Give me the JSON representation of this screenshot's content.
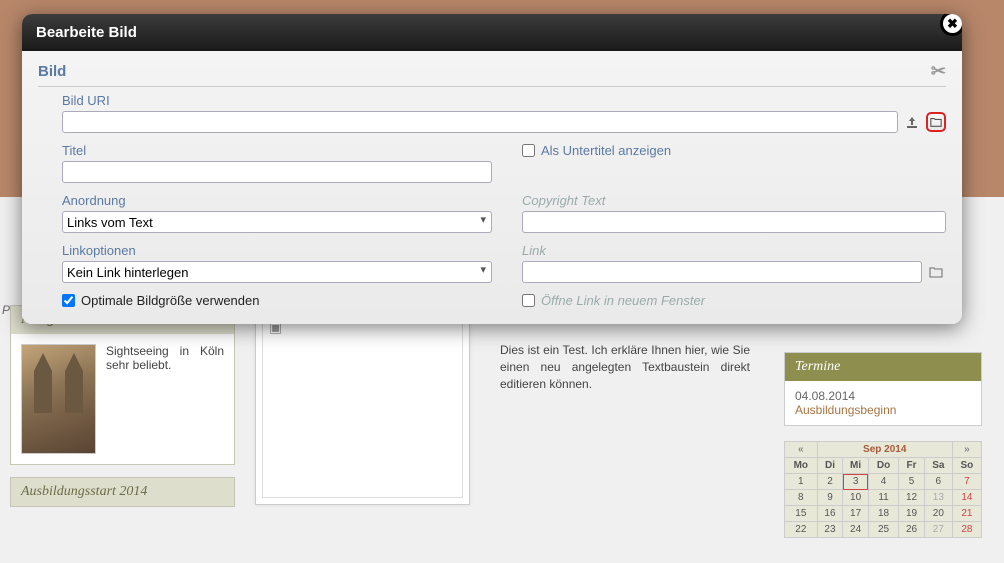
{
  "page": {
    "pl_text": "Pl",
    "center_text": "Dies ist ein Test. Ich erkläre Ihnen hier, wie Sie einen neu angelegten Textbaustein direkt editieren können."
  },
  "news": {
    "heading": "Neuigkeiten aus Köln",
    "item_text": "Sightseeing in Köln sehr beliebt."
  },
  "news2": {
    "heading": "Ausbildungsstart 2014"
  },
  "termine": {
    "heading": "Termine",
    "date": "04.08.2014",
    "title": "Ausbildungsbeginn"
  },
  "calendar": {
    "prev": "«",
    "title": "Sep 2014",
    "next": "»",
    "weekdays": [
      "Mo",
      "Di",
      "Mi",
      "Do",
      "Fr",
      "Sa",
      "So"
    ],
    "rows": [
      [
        "1",
        "2",
        "3",
        "4",
        "5",
        "6",
        "7"
      ],
      [
        "8",
        "9",
        "10",
        "11",
        "12",
        "13",
        "14"
      ],
      [
        "15",
        "16",
        "17",
        "18",
        "19",
        "20",
        "21"
      ],
      [
        "22",
        "23",
        "24",
        "25",
        "26",
        "27",
        "28"
      ]
    ]
  },
  "dialog": {
    "title": "Bearbeite Bild",
    "section": "Bild",
    "uri_label": "Bild URI",
    "titel_label": "Titel",
    "subtitle_label": "Als Untertitel anzeigen",
    "anordnung_label": "Anordnung",
    "anordnung_value": "Links vom Text",
    "copyright_label": "Copyright Text",
    "linkopt_label": "Linkoptionen",
    "linkopt_value": "Kein Link hinterlegen",
    "link_label": "Link",
    "optimize_label": "Optimale Bildgröße verwenden",
    "newwin_label": "Öffne Link in neuem Fenster"
  }
}
